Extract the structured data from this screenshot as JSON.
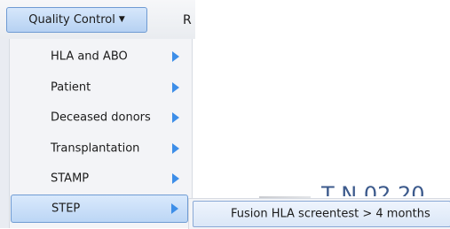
{
  "menubar": {
    "quality_control_label": "Quality Control",
    "caret_icon": "caret-down-icon",
    "next_menu_partial": "R"
  },
  "dropdown": {
    "items": [
      {
        "label": "HLA and ABO",
        "has_submenu": true
      },
      {
        "label": "Patient",
        "has_submenu": true
      },
      {
        "label": "Deceased donors",
        "has_submenu": true
      },
      {
        "label": "Transplantation",
        "has_submenu": true
      },
      {
        "label": "STAMP",
        "has_submenu": true
      },
      {
        "label": "STEP",
        "has_submenu": true,
        "active": true
      }
    ],
    "arrow_icon": "triangle-right-icon",
    "arrow_color": "#3d8ee8"
  },
  "submenu": {
    "items": [
      {
        "label": "Fusion HLA screentest > 4 months"
      }
    ]
  },
  "background": {
    "partial_text": "T   N    02 20"
  },
  "colors": {
    "highlight": "#bcd6f5",
    "highlight_border": "#6f9bd3",
    "menu_bg": "#f3f4f7"
  }
}
